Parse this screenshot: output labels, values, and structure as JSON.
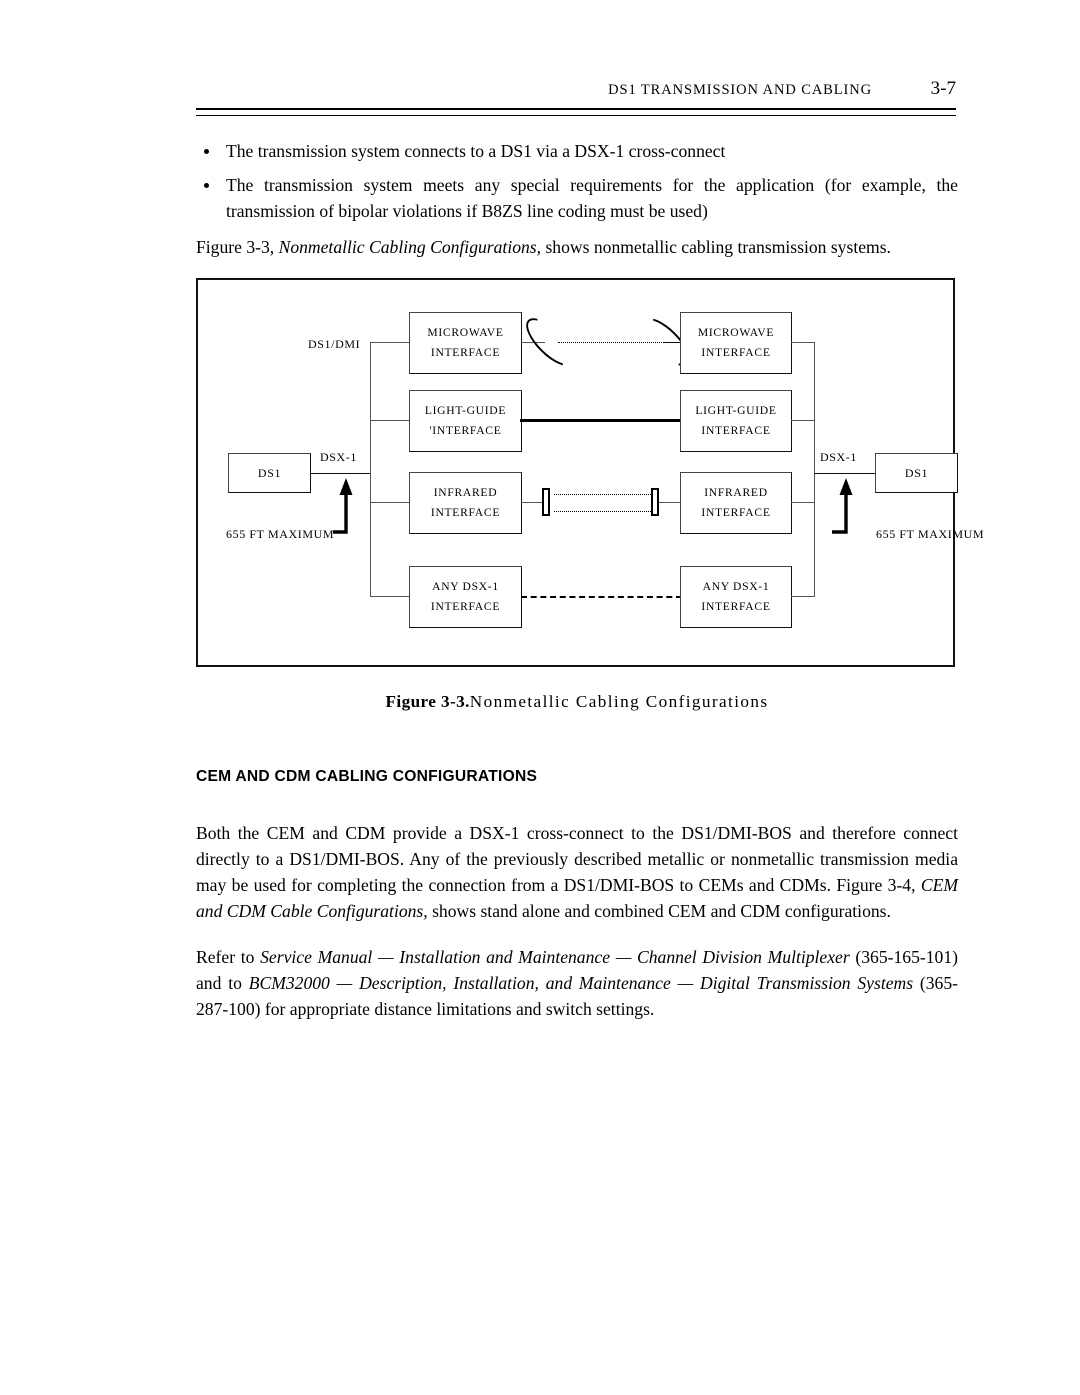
{
  "header": {
    "title": "DS1  TRANSMISSION  AND  CABLING",
    "page_number": "3-7"
  },
  "bullets": [
    "The transmission system connects to a DS1 via a DSX-1 cross-connect",
    "The transmission system meets any special requirements for the application (for example, the transmission of bipolar violations if B8ZS line coding must be used)"
  ],
  "intro": {
    "before": "Figure 3-3, ",
    "italic": "Nonmetallic Cabling Configurations,",
    "after": " shows nonmetallic cabling transmission systems."
  },
  "figure": {
    "caption_bold": "Figure 3-3.",
    "caption_rest": "Nonmetallic   Cabling   Configurations",
    "labels": {
      "ds1_dmi": "DS1/DMI",
      "dsx1_left": "DSX-1",
      "dsx1_right": "DSX-1",
      "max_left_line1": "655 FT",
      "max_left_line2": "MAXIMUM",
      "max_right_line1": "655 FT",
      "max_right_line2": "MAXIMUM"
    },
    "endpoints": {
      "left_ds1": "DS1",
      "right_ds1": "DS1"
    },
    "rows": [
      {
        "id": "microwave",
        "left_line1": "MICROWAVE",
        "left_line2": "INTERFACE",
        "right_line1": "MICROWAVE",
        "right_line2": "INTERFACE",
        "link": "dotted-beam-with-dish-antennas"
      },
      {
        "id": "light-guide",
        "left_line1": "LIGHT-GUIDE",
        "left_line2": "'INTERFACE",
        "right_line1": "LIGHT-GUIDE",
        "right_line2": "INTERFACE",
        "link": "thick-solid-fiber"
      },
      {
        "id": "infrared",
        "left_line1": "INFRARED",
        "left_line2": "INTERFACE",
        "right_line1": "INFRARED",
        "right_line2": "INTERFACE",
        "link": "double-dotted-beam-with-lenses"
      },
      {
        "id": "any-dsx1",
        "left_line1": "ANY  DSX-1",
        "left_line2": "INTERFACE",
        "right_line1": "ANY DSX-1",
        "right_line2": "INTERFACE",
        "link": "dashed-line"
      }
    ]
  },
  "section": {
    "heading": "CEM AND CDM CABLING CONFIGURATIONS"
  },
  "paragraphs": {
    "p1": {
      "part1": "Both the CEM and CDM provide a DSX-1 cross-connect to the DS1/DMI-BOS and therefore connect directly to a DS1/DMI-BOS. Any of the previously described metallic or nonmetallic transmission media may be used for completing the connection from a DS1/DMI-BOS to CEMs and CDMs. Figure 3-4, ",
      "italic1": "CEM and CDM Cable Configurations,",
      "part2": " shows stand alone and combined CEM and CDM configurations."
    },
    "p2": {
      "part1": "Refer to ",
      "italic1": "Service Manual — Installation and Maintenance — Channel Division Multiplexer",
      "part2": " (365-165-101) and to ",
      "italic2": "BCM32000 — Description, Installation, and Maintenance — Digital Transmission Systems",
      "part3": " (365-287-100) for appropriate distance limitations and switch settings."
    }
  },
  "colors": {
    "ink": "#000000",
    "page": "#ffffff",
    "wire": "#555555"
  }
}
